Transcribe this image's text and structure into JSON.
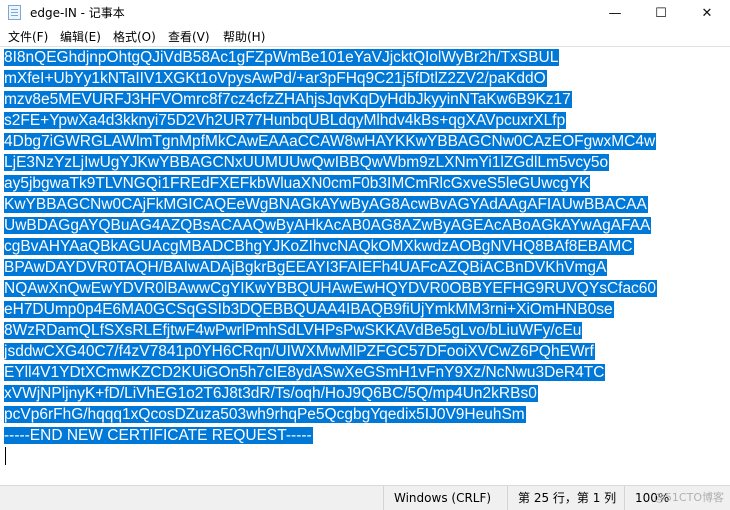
{
  "window": {
    "title": "edge-IN - 记事本",
    "minimize_glyph": "—",
    "maximize_glyph": "☐",
    "close_glyph": "✕",
    "app_icon": "notepad-icon"
  },
  "menu": [
    {
      "label": "文件(F)"
    },
    {
      "label": "编辑(E)"
    },
    {
      "label": "格式(O)"
    },
    {
      "label": "查看(V)"
    },
    {
      "label": "帮助(H)"
    }
  ],
  "editor": {
    "selection_color": "#0078d7",
    "lines": [
      "8I8nQEGhdjnpOhtgQJiVdB58Ac1gFZpWmBe101eYaVJjcktQIolWyBr2h/TxSBUL",
      "mXfeI+UbYy1kNTaIIV1XGKt1oVpysAwPd/+ar3pFHq9C21j5fDtlZ2ZV2/paKddO",
      "mzv8e5MEVURFJ3HFVOmrc8f7cz4cfzZHAhjsJqvKqDyHdbJkyyinNTaKw6B9Kz17",
      "s2FE+YpwXa4d3kknyi75D2Vh2UR77HunbqUBLdqyMlhdv4kBs+qgXAVpcuxrXLfp",
      "4Dbg7iGWRGLAWlmTgnMpfMkCAwEAAaCCAW8wHAYKKwYBBAGCNw0CAzEOFgwxMC4w",
      "LjE3NzYzLjIwUgYJKwYBBAGCNxUUMUUwQwIBBQwWbm9zLXNmYi1lZGdlLm5vcy5o",
      "ay5jbgwaTk9TLVNGQi1FREdFXEFkbWluaXN0cmF0b3IMCmRlcGxveS5leGUwcgYK",
      "KwYBBAGCNw0CAjFkMGICAQEeWgBNAGkAYwByAG8AcwBvAGYAdAAgAFIAUwBBACAA",
      "UwBDAGgAYQBuAG4AZQBsACAAQwByAHkAcAB0AG8AZwByAGEAcABoAGkAYwAgAFAA",
      "cgBvAHYAaQBkAGUAcgMBADCBhgYJKoZIhvcNAQkOMXkwdzAOBgNVHQ8BAf8EBAMC",
      "BPAwDAYDVR0TAQH/BAIwADAjBgkrBgEEAYI3FAIEFh4UAFcAZQBiACBnDVKhVmgA",
      "NQAwXnQwEwYDVR0lBAwwCgYIKwYBBQUHAwEwHQYDVR0OBBYEFHG9RUVQYsCfac60",
      "eH7DUmp0p4E6MA0GCSqGSIb3DQEBBQUAA4IBAQB9fiUjYmkMM3rni+XiOmHNB0se",
      "8WzRDamQLfSXsRLEfjtwF4wPwrlPmhSdLVHPsPwSKKAVdBe5gLvo/bLiuWFy/cEu",
      "jsddwCXG40C7/f4zV7841p0YH6CRqn/UIWXMwMlPZFGC57DFooiXVCwZ6PQhEWrf",
      "EYll4V1YDtXCmwKZCD2KUiGOn5h7cIE8ydASwXeGSmH1vFnY9Xz/NcNwu3DeR4TC",
      "xVWjNPljnyK+fD/LiVhEG1o2T6J8t3dR/Ts/oqh/HoJ9Q6BC/5Q/mp4Un2kRBs0",
      "pcVp6rFhG/hqqq1xQcosDZuza503wh9rhqPe5QcgbgYqedix5IJ0V9HeuhSm",
      "-----END NEW CERTIFICATE REQUEST-----"
    ]
  },
  "status": {
    "line_ending": "Windows (CRLF)",
    "position": "第 25 行，第 1 列",
    "zoom": "100%",
    "watermark": "@51CTO博客"
  }
}
